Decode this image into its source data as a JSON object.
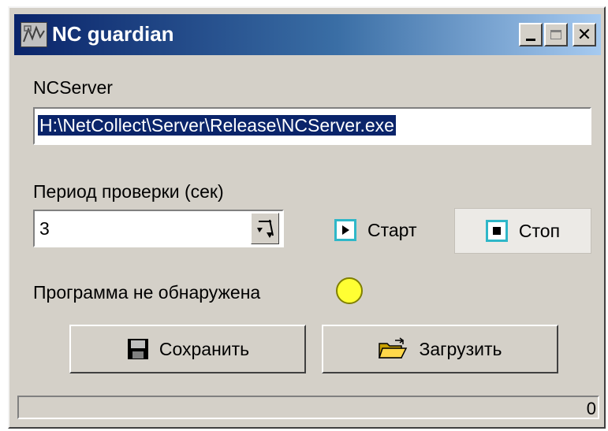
{
  "window": {
    "title": "NC guardian"
  },
  "server": {
    "label": "NCServer",
    "path": "H:\\NetCollect\\Server\\Release\\NCServer.exe"
  },
  "period": {
    "label": "Период проверки (сек)",
    "value": "3"
  },
  "controls": {
    "start_label": "Старт",
    "stop_label": "Стоп"
  },
  "status": {
    "text": "Программа не обнаружена",
    "indicator_color": "#ffff33"
  },
  "actions": {
    "save_label": "Сохранить",
    "load_label": "Загрузить"
  },
  "statusbar": {
    "count": "0"
  },
  "icons": [
    "app-icon",
    "minimize-icon",
    "maximize-icon",
    "close-icon",
    "spin-icon",
    "play-icon",
    "stop-icon",
    "floppy-disk-icon",
    "open-folder-icon"
  ]
}
